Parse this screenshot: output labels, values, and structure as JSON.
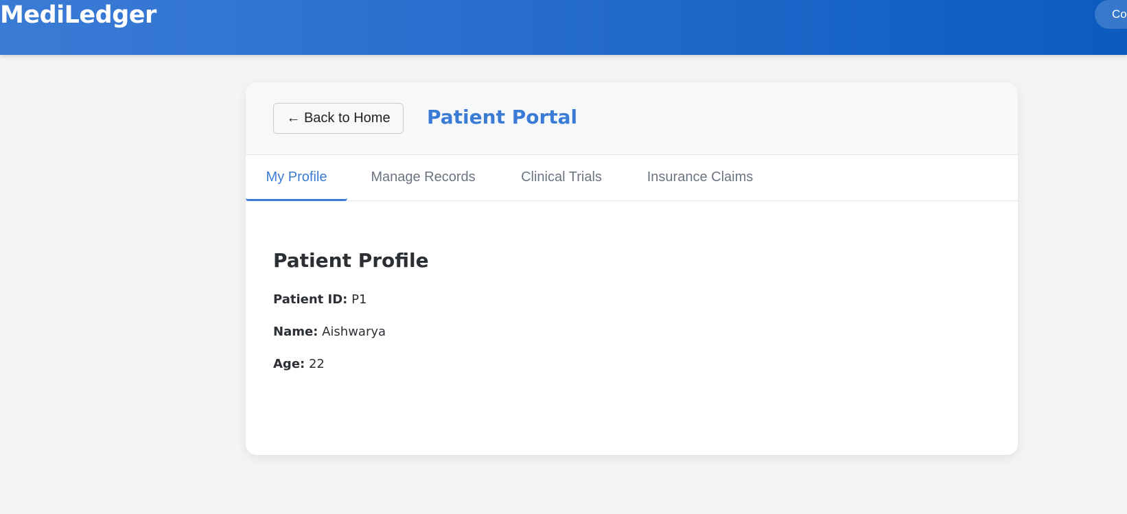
{
  "header": {
    "brand": "MediLedger",
    "connect_label": "Connect Wallet"
  },
  "card": {
    "back_label": "← Back to Home",
    "title": "Patient Portal",
    "tabs": [
      {
        "label": "My Profile",
        "active": true
      },
      {
        "label": "Manage Records",
        "active": false
      },
      {
        "label": "Clinical Trials",
        "active": false
      },
      {
        "label": "Insurance Claims",
        "active": false
      }
    ],
    "profile": {
      "heading": "Patient Profile",
      "fields": [
        {
          "label": "Patient ID:",
          "value": "P1"
        },
        {
          "label": "Name:",
          "value": "Aishwarya"
        },
        {
          "label": "Age:",
          "value": "22"
        }
      ]
    }
  },
  "colors": {
    "accent": "#3a7bd5",
    "header_gradient_start": "#3a7bd5",
    "header_gradient_end": "#0b5bbf",
    "page_background": "#f3f4f4"
  }
}
